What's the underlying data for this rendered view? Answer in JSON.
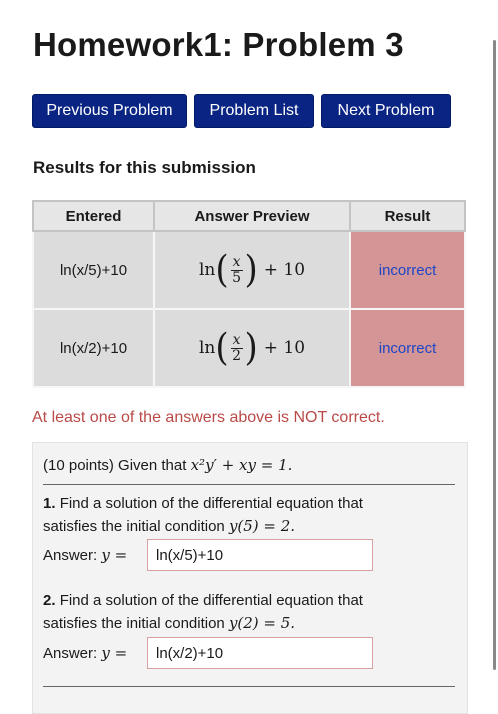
{
  "page": {
    "title": "Homework1: Problem 3"
  },
  "nav": {
    "previous": "Previous Problem",
    "list": "Problem List",
    "next": "Next Problem"
  },
  "results": {
    "heading": "Results for this submission",
    "headers": [
      "Entered",
      "Answer Preview",
      "Result"
    ],
    "rows": [
      {
        "entered": "ln(x/5)+10",
        "preview_fn": "ln",
        "preview_num": "x",
        "preview_den": "5",
        "preview_tail": "+ 10",
        "result": "incorrect"
      },
      {
        "entered": "ln(x/2)+10",
        "preview_fn": "ln",
        "preview_num": "x",
        "preview_den": "2",
        "preview_tail": "+ 10",
        "result": "incorrect"
      }
    ],
    "warning": "At least one of the answers above is NOT correct."
  },
  "problem": {
    "intro": "(10 points) Given that",
    "equation": "x²y′ + xy = 1.",
    "parts": [
      {
        "number": "1.",
        "text_a": "Find a solution of the differential equation that",
        "text_b": "satisfies the initial condition",
        "condition": "y(5) = 2.",
        "answer_label": "Answer:",
        "answer_var": "y =",
        "answer_value": "ln(x/5)+10"
      },
      {
        "number": "2.",
        "text_a": "Find a solution of the differential equation that",
        "text_b": "satisfies the initial condition",
        "condition": "y(2) = 5.",
        "answer_label": "Answer:",
        "answer_var": "y =",
        "answer_value": "ln(x/2)+10"
      }
    ]
  },
  "colors": {
    "button": "#0a2484",
    "incorrect_bg": "#d39595",
    "incorrect_text": "#1e46c8",
    "warning": "#b94a48"
  }
}
